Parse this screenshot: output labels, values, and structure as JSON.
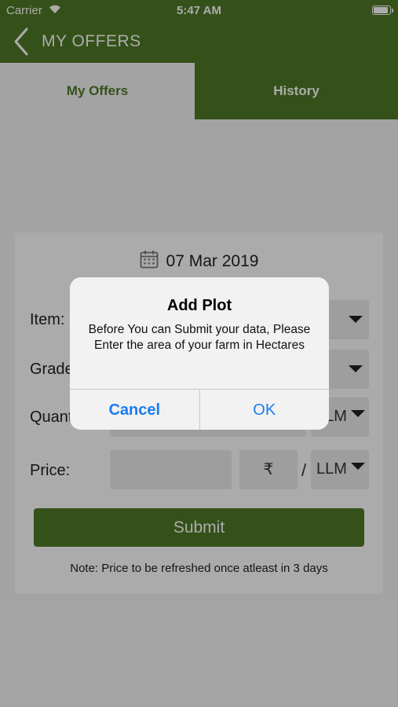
{
  "status_bar": {
    "carrier": "Carrier",
    "time": "5:47 AM",
    "battery_level": 0.95
  },
  "navbar": {
    "title": "MY OFFERS"
  },
  "tabs": [
    {
      "label": "My Offers",
      "active": true
    },
    {
      "label": "History",
      "active": false
    }
  ],
  "form": {
    "date": "07 Mar 2019",
    "item_label": "Item:",
    "grade_label": "Grade",
    "quantity_label": "Quant",
    "quantity_unit": "LLM",
    "price_label": "Price:",
    "currency_symbol": "₹",
    "separator": "/",
    "price_unit": "LLM",
    "submit_label": "Submit",
    "note": "Note: Price to be refreshed once atleast in 3 days"
  },
  "alert": {
    "title": "Add Plot",
    "message": "Before You can Submit your data, Please Enter the area of your farm in Hectares",
    "cancel_label": "Cancel",
    "ok_label": "OK"
  },
  "colors": {
    "brand_green": "#4f7a27",
    "ios_blue": "#1a7cf0"
  }
}
